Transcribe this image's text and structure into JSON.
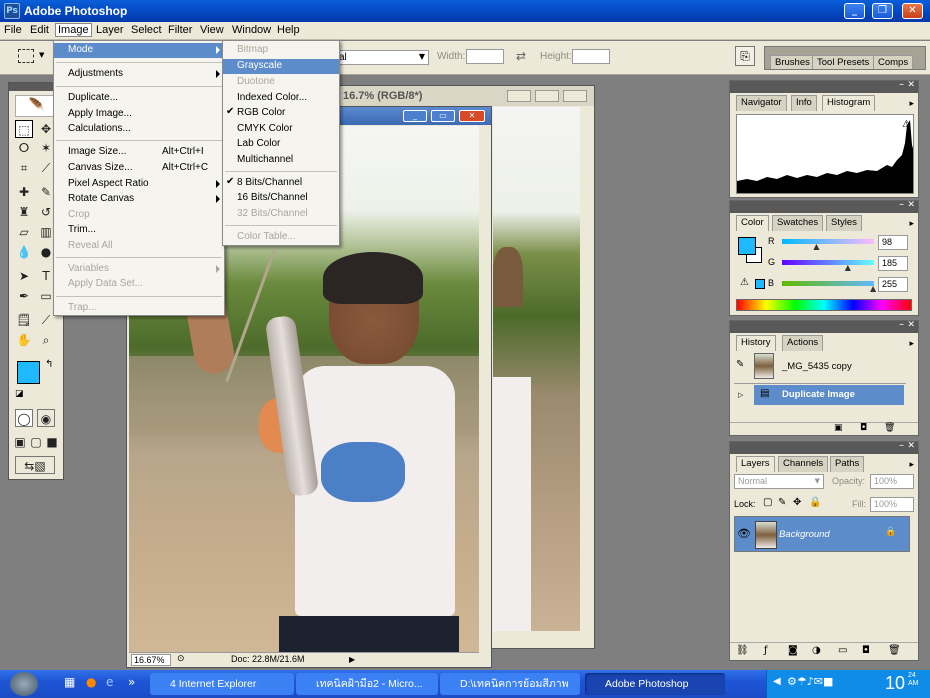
{
  "app": {
    "title": "Adobe Photoshop"
  },
  "menubar": [
    "File",
    "Edit",
    "Image",
    "Layer",
    "Select",
    "Filter",
    "View",
    "Window",
    "Help"
  ],
  "options": {
    "width_label": "Width:",
    "height_label": "Height:",
    "style_value": "al"
  },
  "image_menu": [
    {
      "label": "Mode",
      "arrow": true,
      "highlight": true
    },
    {
      "label": "Adjustments",
      "arrow": true
    },
    {
      "label": "Duplicate..."
    },
    {
      "label": "Apply Image..."
    },
    {
      "label": "Calculations..."
    },
    {
      "label": "Image Size...",
      "shortcut": "Alt+Ctrl+I"
    },
    {
      "label": "Canvas Size...",
      "shortcut": "Alt+Ctrl+C"
    },
    {
      "label": "Pixel Aspect Ratio",
      "arrow": true
    },
    {
      "label": "Rotate Canvas",
      "arrow": true
    },
    {
      "label": "Crop",
      "disabled": true
    },
    {
      "label": "Trim..."
    },
    {
      "label": "Reveal All",
      "disabled": true
    },
    {
      "label": "Variables",
      "arrow": true,
      "disabled": true
    },
    {
      "label": "Apply Data Set...",
      "disabled": true
    },
    {
      "label": "Trap...",
      "disabled": true
    }
  ],
  "mode_menu": [
    {
      "label": "Bitmap",
      "disabled": true
    },
    {
      "label": "Grayscale",
      "highlight": true
    },
    {
      "label": "Duotone",
      "disabled": true
    },
    {
      "label": "Indexed Color..."
    },
    {
      "label": "RGB Color",
      "checked": true
    },
    {
      "label": "CMYK Color"
    },
    {
      "label": "Lab Color"
    },
    {
      "label": "Multichannel"
    },
    {
      "label": "8 Bits/Channel",
      "checked": true
    },
    {
      "label": "16 Bits/Channel"
    },
    {
      "label": "32 Bits/Channel",
      "disabled": true
    },
    {
      "label": "Color Table...",
      "disabled": true
    }
  ],
  "document": {
    "title_fragment": "16.7% (RGB/8*)",
    "zoom": "16.67%",
    "doc_size": "Doc: 22.8M/21.6M"
  },
  "dock_tabs": [
    "Brushes",
    "Tool Presets",
    "Comps"
  ],
  "navigator_panel": {
    "tabs": [
      "Navigator",
      "Info",
      "Histogram"
    ]
  },
  "color_panel": {
    "tabs": [
      "Color",
      "Swatches",
      "Styles"
    ],
    "r_label": "R",
    "g_label": "G",
    "b_label": "B",
    "r": "98",
    "g": "185",
    "b": "255",
    "fg_color": "#1fb9ff"
  },
  "history_panel": {
    "tabs": [
      "History",
      "Actions"
    ],
    "items": [
      "_MG_5435 copy",
      "Duplicate Image"
    ]
  },
  "layers_panel": {
    "tabs": [
      "Layers",
      "Channels",
      "Paths"
    ],
    "blend_mode": "Normal",
    "opacity_label": "Opacity:",
    "opacity": "100%",
    "lock_label": "Lock:",
    "fill_label": "Fill:",
    "fill": "100%",
    "layer_name": "Background"
  },
  "taskbar": {
    "items": [
      "4 Internet Explorer",
      "เทคนิคฝ้ามือ2 - Micro...",
      "D:\\เทคนิคการย้อมสีภาพ",
      "Adobe Photoshop"
    ],
    "clock": "10:24",
    "clock_hour": "10",
    "clock_min": "24",
    "clock_ampm": "AM"
  }
}
